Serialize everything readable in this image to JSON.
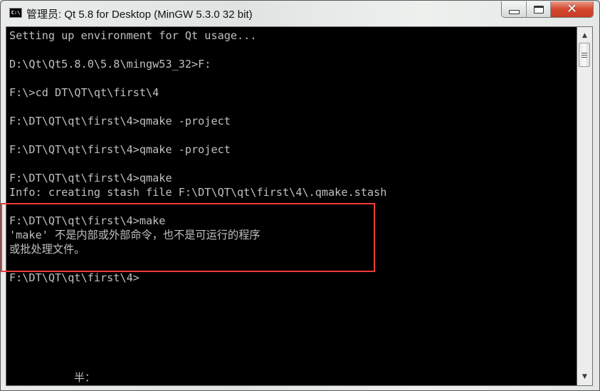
{
  "window": {
    "title": "管理员: Qt 5.8 for Desktop (MinGW 5.3.0 32 bit)",
    "app_icon_text": "C:\\",
    "caption_buttons": {
      "minimize": "minimize",
      "maximize": "maximize",
      "close": "✕"
    }
  },
  "console": {
    "text_color": "#c0c0c0",
    "background_color": "#000000",
    "lines": [
      "Setting up environment for Qt usage...",
      "",
      "D:\\Qt\\Qt5.8.0\\5.8\\mingw53_32>F:",
      "",
      "F:\\>cd DT\\QT\\qt\\first\\4",
      "",
      "F:\\DT\\QT\\qt\\first\\4>qmake -project",
      "",
      "F:\\DT\\QT\\qt\\first\\4>qmake -project",
      "",
      "F:\\DT\\QT\\qt\\first\\4>qmake",
      "Info: creating stash file F:\\DT\\QT\\qt\\first\\4\\.qmake.stash",
      "",
      "F:\\DT\\QT\\qt\\first\\4>make",
      "'make' 不是内部或外部命令，也不是可运行的程序",
      "或批处理文件。",
      "",
      "F:\\DT\\QT\\qt\\first\\4>"
    ],
    "ime_status": "半："
  },
  "annotation": {
    "highlight_color": "#f23a3a",
    "label": "error-highlight"
  },
  "scrollbar": {
    "up_arrow": "▲",
    "down_arrow": "▼"
  }
}
